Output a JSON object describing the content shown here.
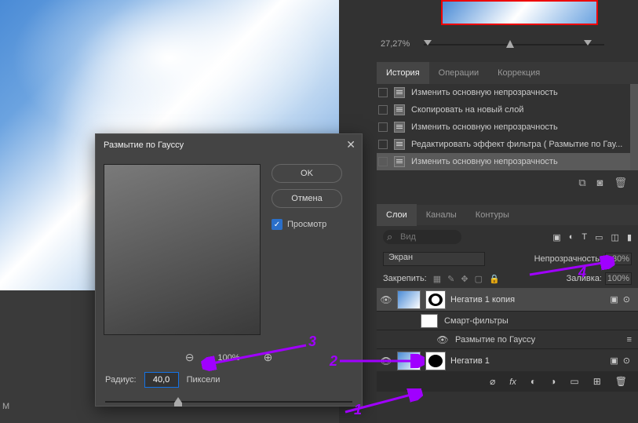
{
  "dialog": {
    "title": "Размытие по Гауссу",
    "ok": "OK",
    "cancel": "Отмена",
    "preview": "Просмотр",
    "zoom": "100%",
    "radius_label": "Радиус:",
    "radius_value": "40,0",
    "radius_unit": "Пиксели"
  },
  "nav": {
    "zoom": "27,27%"
  },
  "history": {
    "tabs": [
      "История",
      "Операции",
      "Коррекция"
    ],
    "items": [
      "Изменить основную непрозрачность",
      "Скопировать на новый слой",
      "Изменить основную непрозрачность",
      "Редактировать эффект фильтра ( Размытие по Гау...",
      "Изменить основную непрозрачность"
    ]
  },
  "layers": {
    "tabs": [
      "Слои",
      "Каналы",
      "Контуры"
    ],
    "search_placeholder": "Вид",
    "blend_mode": "Экран",
    "opacity_label": "Непрозрачность:",
    "opacity_value": "30%",
    "lock_label": "Закрепить:",
    "fill_label": "Заливка:",
    "fill_value": "100%",
    "items": {
      "l1": "Негатив 1 копия",
      "sf": "Смарт-фильтры",
      "gb": "Размытие по Гауссу",
      "l2": "Негатив 1"
    }
  },
  "annotations": {
    "n1": "1",
    "n2": "2",
    "n3": "3",
    "n4": "4"
  },
  "m": "M"
}
